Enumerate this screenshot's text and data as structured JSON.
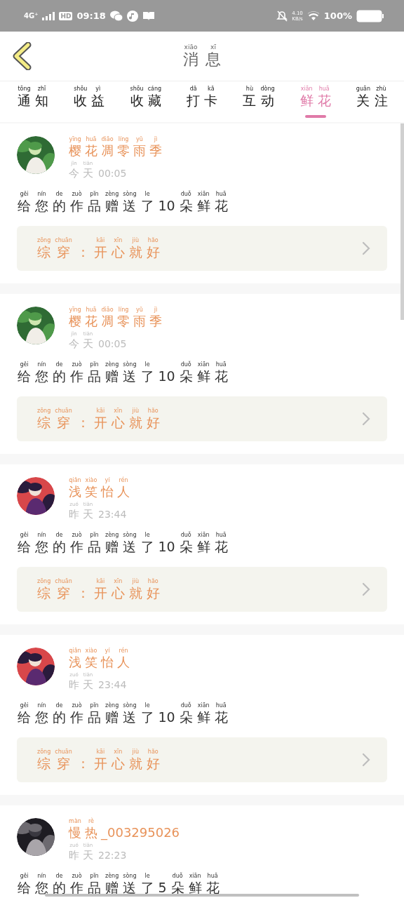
{
  "status_bar": {
    "network": "4G⁺",
    "hd": "HD",
    "time": "09:18",
    "speed": "4.10",
    "speed_unit": "KB/s",
    "battery": "100%"
  },
  "header": {
    "title": [
      [
        "xiāo",
        "消"
      ],
      [
        "xī",
        "息"
      ]
    ]
  },
  "tabs": [
    {
      "label": [
        [
          "tōng",
          "通"
        ],
        [
          "zhī",
          "知"
        ]
      ],
      "selected": false
    },
    {
      "label": [
        [
          "shōu",
          "收"
        ],
        [
          "yì",
          "益"
        ]
      ],
      "selected": false
    },
    {
      "label": [
        [
          "shōu",
          "收"
        ],
        [
          "cáng",
          "藏"
        ]
      ],
      "selected": false
    },
    {
      "label": [
        [
          "dǎ",
          "打"
        ],
        [
          "kǎ",
          "卡"
        ]
      ],
      "selected": false
    },
    {
      "label": [
        [
          "hù",
          "互"
        ],
        [
          "dòng",
          "动"
        ]
      ],
      "selected": false
    },
    {
      "label": [
        [
          "xiān",
          "鲜"
        ],
        [
          "huā",
          "花"
        ]
      ],
      "selected": true
    },
    {
      "label": [
        [
          "guān",
          "关"
        ],
        [
          "zhù",
          "注"
        ]
      ],
      "selected": false
    }
  ],
  "messages": [
    {
      "name": [
        [
          "yīng",
          "樱"
        ],
        [
          "huā",
          "花"
        ],
        [
          "diāo",
          "凋"
        ],
        [
          "líng",
          "零"
        ],
        [
          "yǔ",
          "雨"
        ],
        [
          "jì",
          "季"
        ]
      ],
      "day": [
        [
          "jīn",
          "今"
        ],
        [
          "tiān",
          "天"
        ]
      ],
      "time": "00:05",
      "text": [
        [
          "gěi",
          "给"
        ],
        [
          "nín",
          "您"
        ],
        [
          "de",
          "的"
        ],
        [
          "zuò",
          "作"
        ],
        [
          "pǐn",
          "品"
        ],
        [
          "zèng",
          "赠"
        ],
        [
          "sòng",
          "送"
        ],
        [
          "le",
          "了"
        ],
        [
          "10"
        ],
        [
          "duǒ",
          "朵"
        ],
        [
          "xiān",
          "鲜"
        ],
        [
          "huā",
          "花"
        ]
      ],
      "work": [
        [
          "zōng",
          "综"
        ],
        [
          "chuān",
          "穿"
        ],
        [
          "："
        ],
        [
          "kāi",
          "开"
        ],
        [
          "xīn",
          "心"
        ],
        [
          "jiù",
          "就"
        ],
        [
          "hǎo",
          "好"
        ]
      ]
    },
    {
      "name": [
        [
          "yīng",
          "樱"
        ],
        [
          "huā",
          "花"
        ],
        [
          "diāo",
          "凋"
        ],
        [
          "líng",
          "零"
        ],
        [
          "yǔ",
          "雨"
        ],
        [
          "jì",
          "季"
        ]
      ],
      "day": [
        [
          "jīn",
          "今"
        ],
        [
          "tiān",
          "天"
        ]
      ],
      "time": "00:05",
      "text": [
        [
          "gěi",
          "给"
        ],
        [
          "nín",
          "您"
        ],
        [
          "de",
          "的"
        ],
        [
          "zuò",
          "作"
        ],
        [
          "pǐn",
          "品"
        ],
        [
          "zèng",
          "赠"
        ],
        [
          "sòng",
          "送"
        ],
        [
          "le",
          "了"
        ],
        [
          "10"
        ],
        [
          "duǒ",
          "朵"
        ],
        [
          "xiān",
          "鲜"
        ],
        [
          "huā",
          "花"
        ]
      ],
      "work": [
        [
          "zōng",
          "综"
        ],
        [
          "chuān",
          "穿"
        ],
        [
          "："
        ],
        [
          "kāi",
          "开"
        ],
        [
          "xīn",
          "心"
        ],
        [
          "jiù",
          "就"
        ],
        [
          "hǎo",
          "好"
        ]
      ]
    },
    {
      "name": [
        [
          "qiǎn",
          "浅"
        ],
        [
          "xiào",
          "笑"
        ],
        [
          "yí",
          "怡"
        ],
        [
          "rén",
          "人"
        ]
      ],
      "day": [
        [
          "zuó",
          "昨"
        ],
        [
          "tiān",
          "天"
        ]
      ],
      "time": "23:44",
      "text": [
        [
          "gěi",
          "给"
        ],
        [
          "nín",
          "您"
        ],
        [
          "de",
          "的"
        ],
        [
          "zuò",
          "作"
        ],
        [
          "pǐn",
          "品"
        ],
        [
          "zèng",
          "赠"
        ],
        [
          "sòng",
          "送"
        ],
        [
          "le",
          "了"
        ],
        [
          "10"
        ],
        [
          "duǒ",
          "朵"
        ],
        [
          "xiān",
          "鲜"
        ],
        [
          "huā",
          "花"
        ]
      ],
      "work": [
        [
          "zōng",
          "综"
        ],
        [
          "chuān",
          "穿"
        ],
        [
          "："
        ],
        [
          "kāi",
          "开"
        ],
        [
          "xīn",
          "心"
        ],
        [
          "jiù",
          "就"
        ],
        [
          "hǎo",
          "好"
        ]
      ]
    },
    {
      "name": [
        [
          "qiǎn",
          "浅"
        ],
        [
          "xiào",
          "笑"
        ],
        [
          "yí",
          "怡"
        ],
        [
          "rén",
          "人"
        ]
      ],
      "day": [
        [
          "zuó",
          "昨"
        ],
        [
          "tiān",
          "天"
        ]
      ],
      "time": "23:44",
      "text": [
        [
          "gěi",
          "给"
        ],
        [
          "nín",
          "您"
        ],
        [
          "de",
          "的"
        ],
        [
          "zuò",
          "作"
        ],
        [
          "pǐn",
          "品"
        ],
        [
          "zèng",
          "赠"
        ],
        [
          "sòng",
          "送"
        ],
        [
          "le",
          "了"
        ],
        [
          "10"
        ],
        [
          "duǒ",
          "朵"
        ],
        [
          "xiān",
          "鲜"
        ],
        [
          "huā",
          "花"
        ]
      ],
      "work": [
        [
          "zōng",
          "综"
        ],
        [
          "chuān",
          "穿"
        ],
        [
          "："
        ],
        [
          "kāi",
          "开"
        ],
        [
          "xīn",
          "心"
        ],
        [
          "jiù",
          "就"
        ],
        [
          "hǎo",
          "好"
        ]
      ]
    },
    {
      "name": [
        [
          "màn",
          "慢"
        ],
        [
          "rè",
          "热"
        ],
        [
          "_003295026"
        ]
      ],
      "day": [
        [
          "zuó",
          "昨"
        ],
        [
          "tiān",
          "天"
        ]
      ],
      "time": "22:23",
      "text": [
        [
          "gěi",
          "给"
        ],
        [
          "nín",
          "您"
        ],
        [
          "de",
          "的"
        ],
        [
          "zuò",
          "作"
        ],
        [
          "pǐn",
          "品"
        ],
        [
          "zèng",
          "赠"
        ],
        [
          "sòng",
          "送"
        ],
        [
          "le",
          "了"
        ],
        [
          "5"
        ],
        [
          "duǒ",
          "朵"
        ],
        [
          "xiān",
          "鲜"
        ],
        [
          "huā",
          "花"
        ]
      ]
    }
  ]
}
